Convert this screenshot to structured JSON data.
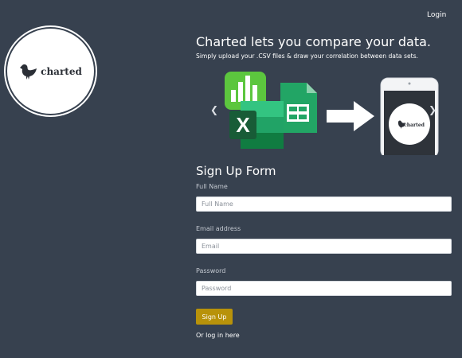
{
  "nav": {
    "login_label": "Login"
  },
  "brand": {
    "name": "charted",
    "icon": "bird-icon"
  },
  "hero": {
    "headline": "Charted lets you compare your data.",
    "subline": "Simply upload your .CSV files & draw your correlation between data sets."
  },
  "carousel": {
    "prev_icon": "chevron-left-icon",
    "next_icon": "chevron-right-icon",
    "spreadsheet_letter": "X",
    "phone_brand": "charted"
  },
  "form": {
    "title": "Sign Up Form",
    "full_name": {
      "label": "Full Name",
      "placeholder": "Full Name",
      "value": ""
    },
    "email": {
      "label": "Email address",
      "placeholder": "Email",
      "value": ""
    },
    "password": {
      "label": "Password",
      "placeholder": "Password",
      "value": ""
    },
    "submit_label": "Sign Up",
    "login_link": "Or log in here"
  },
  "colors": {
    "background": "#37414f",
    "button": "#b8920a",
    "sheets_green": "#22a565",
    "excel_green": "#1d6f42",
    "numbers_green": "#5cc63e"
  }
}
